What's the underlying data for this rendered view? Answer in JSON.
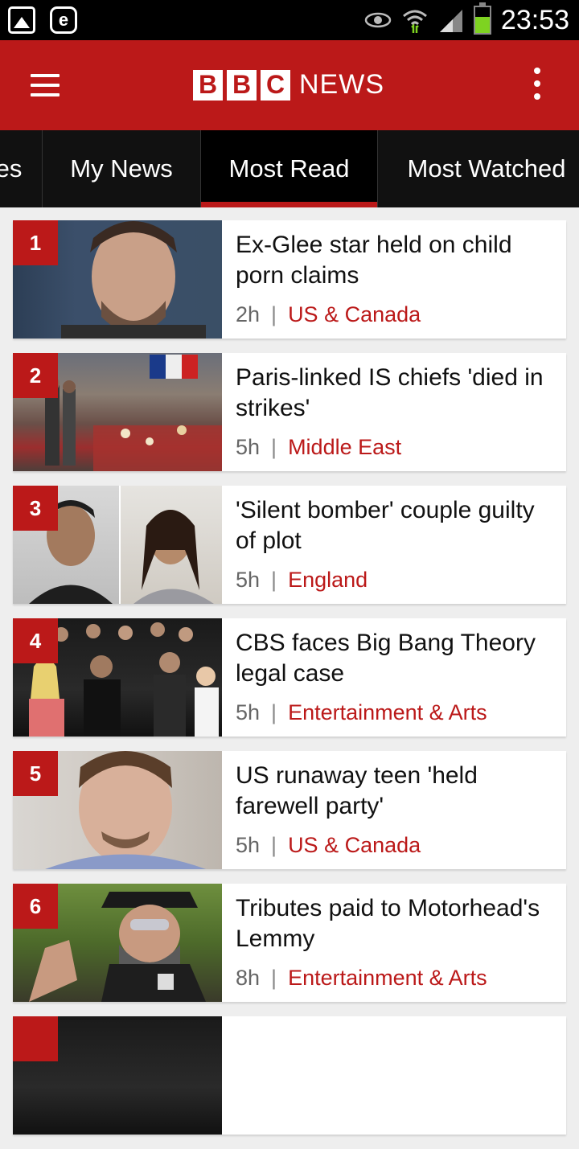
{
  "status_bar": {
    "time": "23:53"
  },
  "header": {
    "logo_letters": [
      "B",
      "B",
      "C"
    ],
    "logo_news": "NEWS"
  },
  "tabs": [
    {
      "label": "es"
    },
    {
      "label": "My News"
    },
    {
      "label": "Most Read"
    },
    {
      "label": "Most Watched"
    }
  ],
  "articles": [
    {
      "rank": "1",
      "headline": "Ex-Glee star held on child porn claims",
      "age": "2h",
      "section": "US & Canada"
    },
    {
      "rank": "2",
      "headline": "Paris-linked IS chiefs 'died in strikes'",
      "age": "5h",
      "section": "Middle East"
    },
    {
      "rank": "3",
      "headline": "'Silent bomber' couple guilty of plot",
      "age": "5h",
      "section": "England"
    },
    {
      "rank": "4",
      "headline": "CBS faces Big Bang Theory legal case",
      "age": "5h",
      "section": "Entertainment & Arts"
    },
    {
      "rank": "5",
      "headline": "US runaway teen 'held farewell party'",
      "age": "5h",
      "section": "US & Canada"
    },
    {
      "rank": "6",
      "headline": "Tributes paid to Motorhead's Lemmy",
      "age": "8h",
      "section": "Entertainment & Arts"
    }
  ],
  "colors": {
    "brand_red": "#bb1919",
    "tab_bar": "#111111"
  }
}
